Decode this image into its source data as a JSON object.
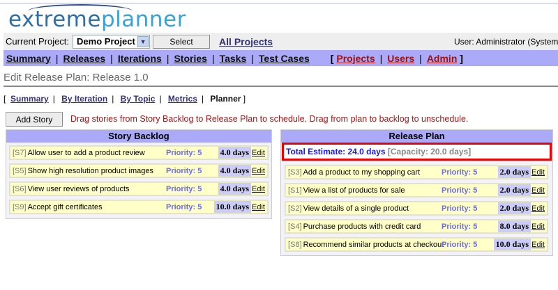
{
  "logo": {
    "part1": "extreme",
    "part2": "planner"
  },
  "toolbar": {
    "current_project_label": "Current Project:",
    "project_value": "Demo Project",
    "select_label": "Select",
    "all_projects": "All Projects",
    "user": "User: Administrator (System Adr"
  },
  "nav": {
    "items": [
      "Summary",
      "Releases",
      "Iterations",
      "Stories",
      "Tasks",
      "Test Cases"
    ],
    "admin_items": [
      "Projects",
      "Users",
      "Admin"
    ]
  },
  "page_title": "Edit Release Plan: Release 1.0",
  "subnav": {
    "items": [
      "Summary",
      "By Iteration",
      "By Topic",
      "Metrics"
    ],
    "current": "Planner"
  },
  "add_story": "Add Story",
  "hint": "Drag stories from Story Backlog to Release Plan to schedule. Drag from plan to backlog to unschedule.",
  "backlog": {
    "title": "Story Backlog",
    "stories": [
      {
        "id": "[S7]",
        "title": "Allow user to add a product review",
        "priority": "Priority: 5",
        "estimate": "4.0 days",
        "edit": "Edit"
      },
      {
        "id": "[S5]",
        "title": "Show high resolution product images",
        "priority": "Priority: 5",
        "estimate": "4.0 days",
        "edit": "Edit"
      },
      {
        "id": "[S6]",
        "title": "View user reviews of products",
        "priority": "Priority: 5",
        "estimate": "4.0 days",
        "edit": "Edit"
      },
      {
        "id": "[S9]",
        "title": "Accept gift certificates",
        "priority": "Priority: 5",
        "estimate": "10.0 days",
        "edit": "Edit"
      }
    ]
  },
  "plan": {
    "title": "Release Plan",
    "total": "Total Estimate: 24.0 days",
    "capacity": "[Capacity: 20.0 days]",
    "stories": [
      {
        "id": "[S3]",
        "title": "Add a product to my shopping cart",
        "priority": "Priority: 5",
        "estimate": "2.0 days",
        "edit": "Edit"
      },
      {
        "id": "[S1]",
        "title": "View a list of products for sale",
        "priority": "Priority: 5",
        "estimate": "2.0 days",
        "edit": "Edit"
      },
      {
        "id": "[S2]",
        "title": "View details of a single product",
        "priority": "Priority: 5",
        "estimate": "2.0 days",
        "edit": "Edit"
      },
      {
        "id": "[S4]",
        "title": "Purchase products with credit card",
        "priority": "Priority: 5",
        "estimate": "8.0 days",
        "edit": "Edit"
      },
      {
        "id": "[S8]",
        "title": "Recommend similar products at checkout",
        "priority": "Priority: 5",
        "estimate": "10.0 days",
        "edit": "Edit"
      }
    ]
  }
}
